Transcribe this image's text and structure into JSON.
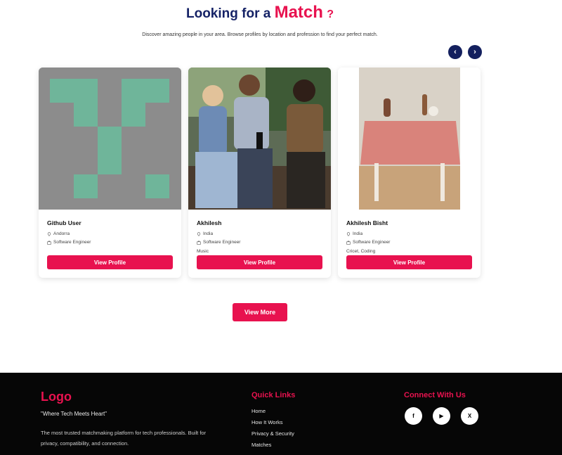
{
  "header": {
    "title_prefix": "Looking for a",
    "title_accent": "Match",
    "title_suffix": "?",
    "subtitle": "Discover amazing people in your area. Browse profiles by location and profession to find your perfect match."
  },
  "carousel": {
    "prev_icon": "‹",
    "next_icon": "›"
  },
  "profiles": [
    {
      "name": "Github User",
      "location": "Andorra",
      "profession": "Software Engineer",
      "interests": "",
      "button": "View Profile"
    },
    {
      "name": "Akhilesh",
      "location": "India",
      "profession": "Software Engineer",
      "interests": "Music",
      "button": "View Profile"
    },
    {
      "name": "Akhilesh Bisht",
      "location": "India",
      "profession": "Software Engineer",
      "interests": "Cricet, Coding",
      "button": "View Profile"
    }
  ],
  "view_more": "View More",
  "footer": {
    "logo": "Logo",
    "tagline": "\"Where Tech Meets Heart\"",
    "description": "The most trusted matchmaking platform for tech professionals. Built for privacy, compatibility, and connection.",
    "quick_links_title": "Quick Links",
    "quick_links": [
      "Home",
      "How It Works",
      "Privacy & Security",
      "Matches"
    ],
    "connect_title": "Connect With Us",
    "social": {
      "facebook": "f",
      "youtube": "▶",
      "x": "X"
    }
  },
  "colors": {
    "accent": "#e8124f",
    "navy": "#152266",
    "footer_bg": "#060606"
  }
}
